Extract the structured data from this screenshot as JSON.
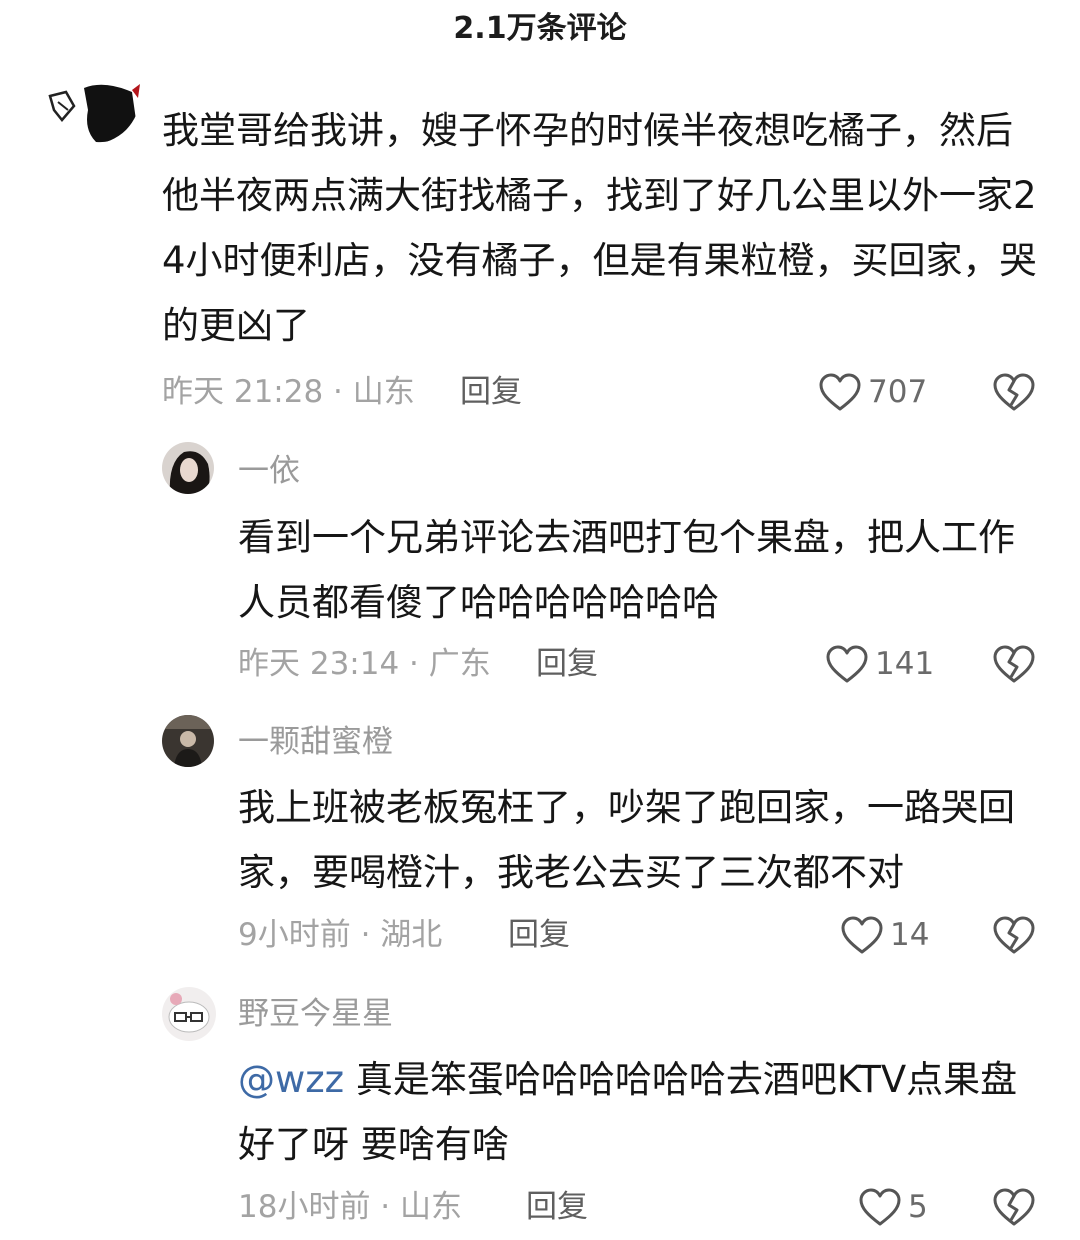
{
  "header": {
    "title": "2.1万条评论"
  },
  "comments": [
    {
      "username": "",
      "text": "我堂哥给我讲，嫂子怀孕的时候半夜想吃橘子，然后他半夜两点满大街找橘子，找到了好几公里以外一家24小时便利店，没有橘子，但是有果粒橙，买回家，哭的更凶了",
      "meta": "昨天 21:28 · 山东",
      "reply_label": "回复",
      "likes": "707"
    }
  ],
  "replies": [
    {
      "username": "一依",
      "text": "看到一个兄弟评论去酒吧打包个果盘，把人工作人员都看傻了哈哈哈哈哈哈哈",
      "meta": "昨天 23:14 · 广东",
      "reply_label": "回复",
      "likes": "141"
    },
    {
      "username": "一颗甜蜜橙",
      "text": "我上班被老板冤枉了，吵架了跑回家，一路哭回家，要喝橙汁，我老公去买了三次都不对",
      "meta": "9小时前 · 湖北",
      "reply_label": "回复",
      "likes": "14"
    },
    {
      "username": "野豆今星星",
      "mention": "@wzz",
      "text": " 真是笨蛋哈哈哈哈哈哈去酒吧KTV点果盘好了呀 要啥有啥",
      "meta": "18小时前 · 山东",
      "reply_label": "回复",
      "likes": "5"
    }
  ],
  "icons": {
    "like": "heart-outline-icon",
    "dislike": "broken-heart-icon"
  },
  "colors": {
    "text": "#161616",
    "meta": "#a3a3a3",
    "username": "#9a9a9a",
    "mention": "#3e6aa6"
  }
}
